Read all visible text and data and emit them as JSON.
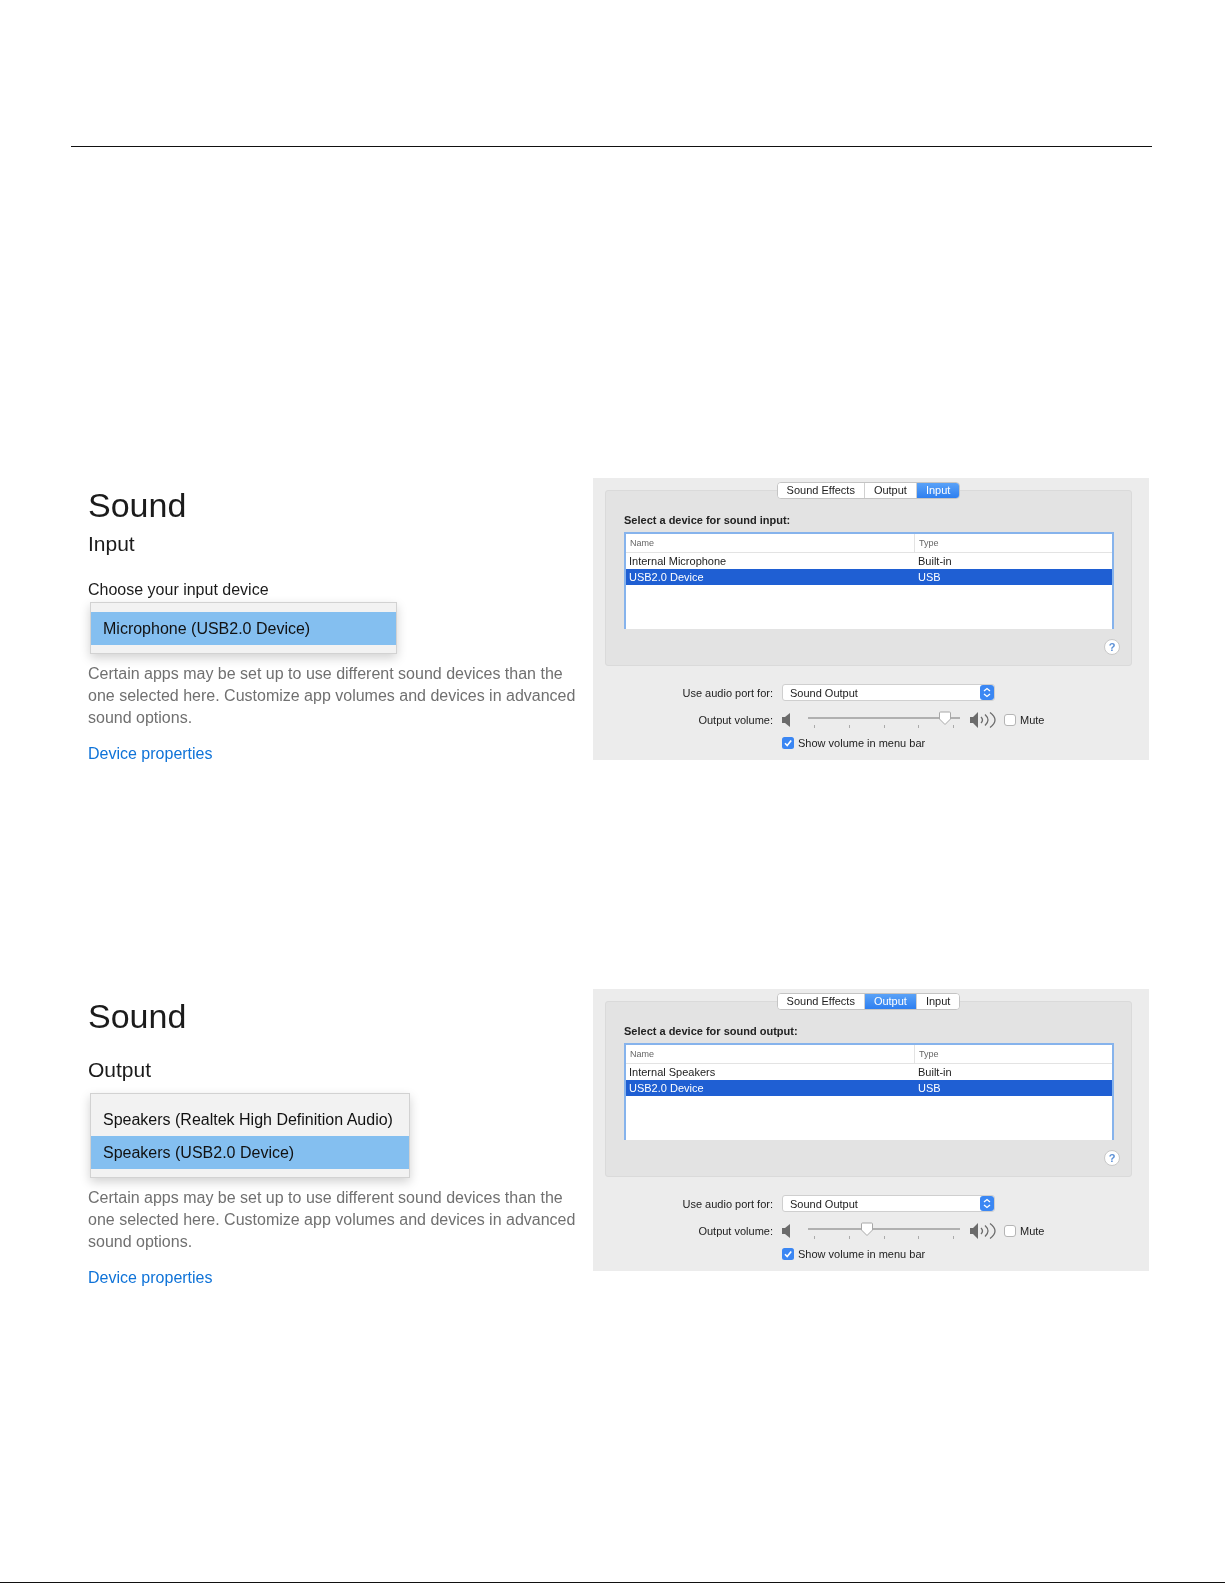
{
  "sections": [
    {
      "settings": {
        "title": "Sound",
        "subtitle": "Input",
        "label": "Choose your input device",
        "options": [
          {
            "text": "Microphone (USB2.0 Device)",
            "selected": true
          }
        ],
        "description": "Certain apps may be set up to use different sound devices than the one selected here. Customize app volumes and devices in advanced sound options.",
        "link": "Device properties"
      },
      "preferences": {
        "tabs": [
          {
            "label": "Sound Effects",
            "selected": false
          },
          {
            "label": "Output",
            "selected": false
          },
          {
            "label": "Input",
            "selected": true
          }
        ],
        "heading": "Select a device for sound input:",
        "table": {
          "columns": [
            "Name",
            "Type"
          ],
          "rows": [
            {
              "cells": [
                "Internal Microphone",
                "Built-in"
              ],
              "selected": false
            },
            {
              "cells": [
                "USB2.0 Device",
                "USB"
              ],
              "selected": true
            }
          ]
        },
        "help_button": "?",
        "audio_port": {
          "label": "Use audio port for:",
          "value": "Sound Output"
        },
        "volume": {
          "label": "Output volume:",
          "level": 0.9
        },
        "mute": {
          "label": "Mute",
          "checked": false
        },
        "menu_bar": {
          "label": "Show volume in menu bar",
          "checked": true
        }
      }
    },
    {
      "settings": {
        "title": "Sound",
        "subtitle": "Output",
        "options": [
          {
            "text": "Speakers (Realtek High Definition Audio)",
            "selected": false
          },
          {
            "text": "Speakers (USB2.0 Device)",
            "selected": true
          }
        ],
        "description": "Certain apps may be set up to use different sound devices than the one selected here. Customize app volumes and devices in advanced sound options.",
        "link": "Device properties"
      },
      "preferences": {
        "tabs": [
          {
            "label": "Sound Effects",
            "selected": false
          },
          {
            "label": "Output",
            "selected": true
          },
          {
            "label": "Input",
            "selected": false
          }
        ],
        "heading": "Select a device for sound output:",
        "table": {
          "columns": [
            "Name",
            "Type"
          ],
          "rows": [
            {
              "cells": [
                "Internal Speakers",
                "Built-in"
              ],
              "selected": false
            },
            {
              "cells": [
                "USB2.0 Device",
                "USB"
              ],
              "selected": true
            }
          ]
        },
        "help_button": "?",
        "audio_port": {
          "label": "Use audio port for:",
          "value": "Sound Output"
        },
        "volume": {
          "label": "Output volume:",
          "level": 0.39
        },
        "mute": {
          "label": "Mute",
          "checked": false
        },
        "menu_bar": {
          "label": "Show volume in menu bar",
          "checked": true
        }
      }
    }
  ]
}
